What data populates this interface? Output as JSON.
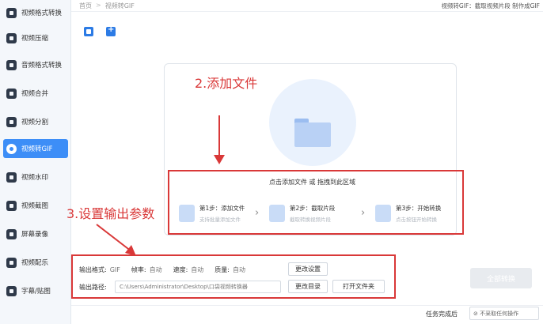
{
  "sidebar": {
    "items": [
      {
        "label": "视频格式转换",
        "active": false
      },
      {
        "label": "视频压缩",
        "active": false
      },
      {
        "label": "音频格式转换",
        "active": false
      },
      {
        "label": "视频合并",
        "active": false
      },
      {
        "label": "视频分割",
        "active": false
      },
      {
        "label": "视频转GIF",
        "active": true
      },
      {
        "label": "视频水印",
        "active": false
      },
      {
        "label": "视频截图",
        "active": false
      },
      {
        "label": "屏幕录像",
        "active": false
      },
      {
        "label": "视频配乐",
        "active": false
      },
      {
        "label": "字幕/贴图",
        "active": false
      }
    ]
  },
  "header": {
    "breadcrumb": [
      "首页",
      "视频转GIF"
    ],
    "description": "视频转GIF：截取视频片段 制作成GIF"
  },
  "drop_area": {
    "title": "点击添加文件 或 拖拽到此区域",
    "steps": [
      {
        "title": "第1步：添加文件",
        "sub": "支持批量添加文件"
      },
      {
        "title": "第2步：截取片段",
        "sub": "截取转换视频片段"
      },
      {
        "title": "第3步：开始转换",
        "sub": "点击按钮开始转换"
      }
    ],
    "arrow_glyph": "›"
  },
  "annotations": {
    "step2": "2.添加文件",
    "step3": "3.设置输出参数"
  },
  "settings": {
    "format_label": "输出格式:",
    "format_value": "GIF",
    "fps_label": "帧率:",
    "fps_value": "自动",
    "speed_label": "速度:",
    "speed_value": "自动",
    "quality_label": "质量:",
    "quality_value": "自动",
    "change_settings": "更改设置",
    "path_label": "输出路径:",
    "path_value": "C:\\Users\\Administrator\\Desktop\\口袋视频转换器",
    "change_dir": "更改目录",
    "open_folder": "打开文件夹"
  },
  "convert_all": "全部转换",
  "footer": {
    "label": "任务完成后",
    "option": "⊘ 不采取任何操作"
  },
  "colors": {
    "accent": "#3d8ef7",
    "annotation_red": "#d93838"
  }
}
